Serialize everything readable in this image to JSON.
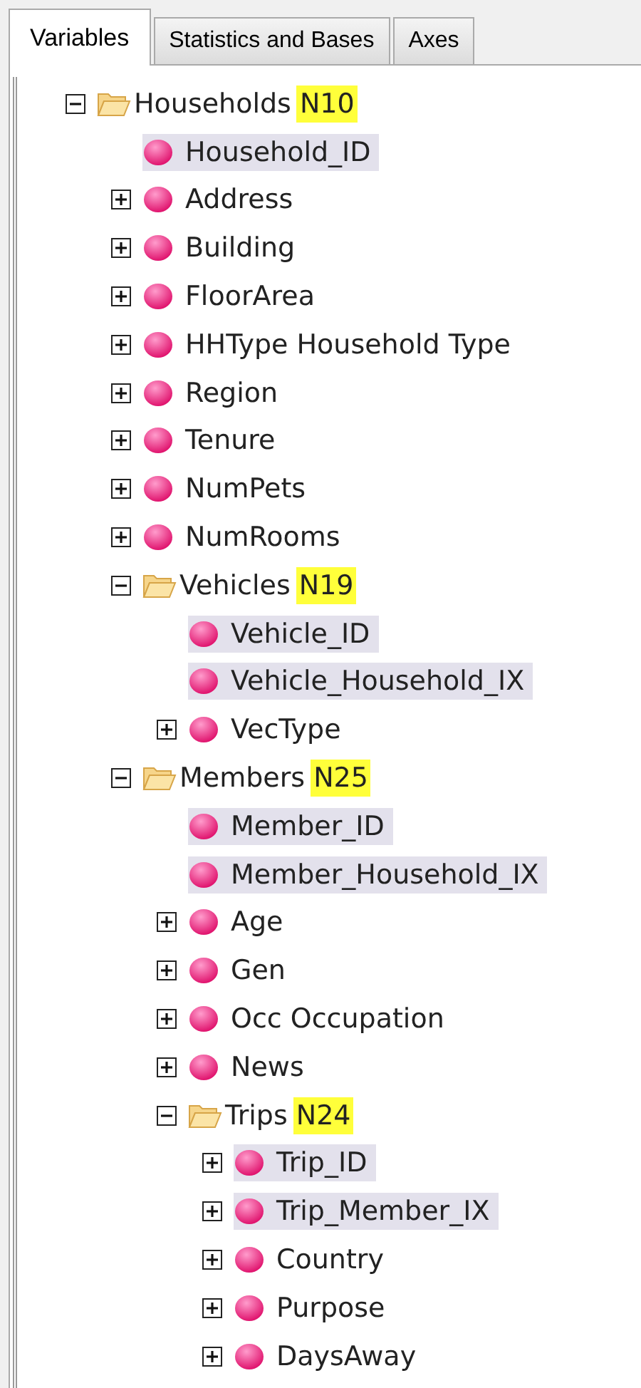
{
  "tabs": [
    {
      "label": "Variables",
      "selected": true
    },
    {
      "label": "Statistics and Bases",
      "selected": false
    },
    {
      "label": "Axes",
      "selected": false
    }
  ],
  "tree": [
    {
      "kind": "folder",
      "label": "Households",
      "badge": "N10",
      "expanded": true,
      "children": [
        {
          "kind": "variable",
          "label": "Household_ID",
          "expandable": false,
          "highlighted": true
        },
        {
          "kind": "variable",
          "label": "Address",
          "expandable": true,
          "highlighted": false
        },
        {
          "kind": "variable",
          "label": "Building",
          "expandable": true,
          "highlighted": false
        },
        {
          "kind": "variable",
          "label": "FloorArea",
          "expandable": true,
          "highlighted": false
        },
        {
          "kind": "variable",
          "label": "HHType Household Type",
          "expandable": true,
          "highlighted": false
        },
        {
          "kind": "variable",
          "label": "Region",
          "expandable": true,
          "highlighted": false
        },
        {
          "kind": "variable",
          "label": "Tenure",
          "expandable": true,
          "highlighted": false
        },
        {
          "kind": "variable",
          "label": "NumPets",
          "expandable": true,
          "highlighted": false
        },
        {
          "kind": "variable",
          "label": "NumRooms",
          "expandable": true,
          "highlighted": false
        },
        {
          "kind": "folder",
          "label": "Vehicles",
          "badge": "N19",
          "expanded": true,
          "children": [
            {
              "kind": "variable",
              "label": "Vehicle_ID",
              "expandable": false,
              "highlighted": true
            },
            {
              "kind": "variable",
              "label": "Vehicle_Household_IX",
              "expandable": false,
              "highlighted": true
            },
            {
              "kind": "variable",
              "label": "VecType",
              "expandable": true,
              "highlighted": false
            }
          ]
        },
        {
          "kind": "folder",
          "label": "Members",
          "badge": "N25",
          "expanded": true,
          "children": [
            {
              "kind": "variable",
              "label": "Member_ID",
              "expandable": false,
              "highlighted": true
            },
            {
              "kind": "variable",
              "label": "Member_Household_IX",
              "expandable": false,
              "highlighted": true
            },
            {
              "kind": "variable",
              "label": "Age",
              "expandable": true,
              "highlighted": false
            },
            {
              "kind": "variable",
              "label": "Gen",
              "expandable": true,
              "highlighted": false
            },
            {
              "kind": "variable",
              "label": "Occ Occupation",
              "expandable": true,
              "highlighted": false
            },
            {
              "kind": "variable",
              "label": "News",
              "expandable": true,
              "highlighted": false
            },
            {
              "kind": "folder",
              "label": "Trips",
              "badge": "N24",
              "expanded": true,
              "children": [
                {
                  "kind": "variable",
                  "label": "Trip_ID",
                  "expandable": true,
                  "highlighted": true
                },
                {
                  "kind": "variable",
                  "label": "Trip_Member_IX",
                  "expandable": true,
                  "highlighted": true
                },
                {
                  "kind": "variable",
                  "label": "Country",
                  "expandable": true,
                  "highlighted": false
                },
                {
                  "kind": "variable",
                  "label": "Purpose",
                  "expandable": true,
                  "highlighted": false
                },
                {
                  "kind": "variable",
                  "label": "DaysAway",
                  "expandable": true,
                  "highlighted": false
                }
              ]
            }
          ]
        }
      ]
    }
  ]
}
